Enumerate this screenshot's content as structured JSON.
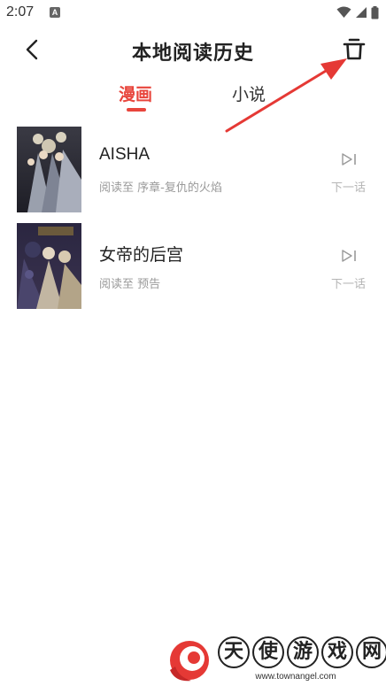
{
  "status_bar": {
    "time": "2:07",
    "notification_icon": "a-app-icon",
    "icons": [
      "wifi-icon",
      "signal-icon",
      "battery-icon"
    ]
  },
  "header": {
    "title": "本地阅读历史",
    "back_icon": "chevron-left-icon",
    "delete_icon": "trash-icon"
  },
  "tabs": [
    {
      "label": "漫画",
      "active": true
    },
    {
      "label": "小说",
      "active": false
    }
  ],
  "history": [
    {
      "title": "AISHA",
      "progress": "阅读至 序章-复仇的火焰",
      "next_label": "下一话",
      "cover_colors": [
        "#2b2b33",
        "#8a8f9c"
      ]
    },
    {
      "title": "女帝的后宫",
      "progress": "阅读至 预告",
      "next_label": "下一话",
      "cover_colors": [
        "#2a2640",
        "#c8b8a0"
      ]
    }
  ],
  "watermark": {
    "chars": [
      "天",
      "使",
      "游",
      "戏",
      "网"
    ],
    "url": "www.townangel.com"
  },
  "colors": {
    "accent": "#e8453c",
    "annotation": "#e53935"
  }
}
